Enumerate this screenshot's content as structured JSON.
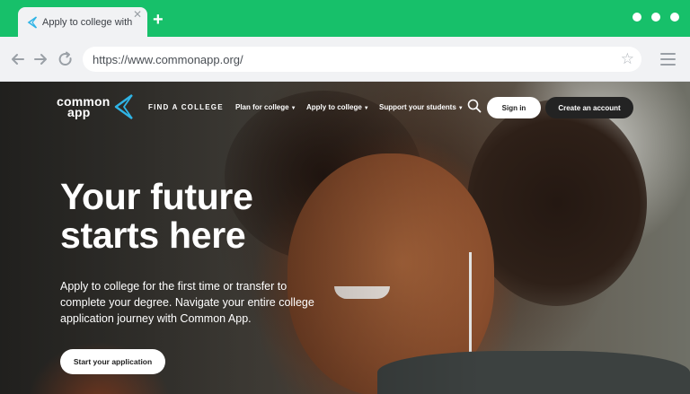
{
  "browser": {
    "tab_title": "Apply to college with",
    "tab_close": "✕",
    "new_tab": "+",
    "url": "https://www.commonapp.org/",
    "accent_color": "#17c06a"
  },
  "site": {
    "logo": {
      "line1": "common",
      "line2": "app",
      "mark_color": "#2fb4e6"
    },
    "nav": {
      "find_college": "FIND A COLLEGE",
      "items": [
        {
          "label": "Plan for college"
        },
        {
          "label": "Apply to college"
        },
        {
          "label": "Support your students"
        }
      ],
      "sign_in": "Sign in",
      "create_account": "Create an account"
    },
    "hero": {
      "title_line1": "Your future",
      "title_line2": "starts here",
      "body": "Apply to college for the first time or transfer to complete your degree. Navigate your entire college application journey with Common App.",
      "cta": "Start your application"
    }
  }
}
